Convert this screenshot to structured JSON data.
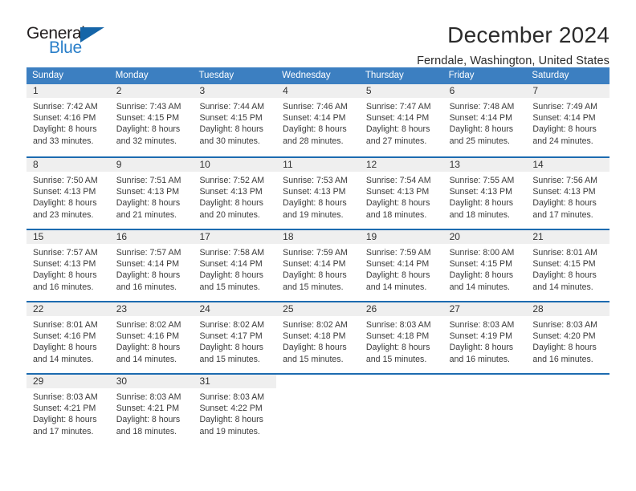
{
  "brand": {
    "name_part1": "General",
    "name_part2": "Blue",
    "triangle_icon": "triangle-icon",
    "color_dark": "#231f20",
    "color_blue": "#2a7fc9"
  },
  "header": {
    "title": "December 2024",
    "location": "Ferndale, Washington, United States"
  },
  "calendar": {
    "header_bg": "#3c7fc1",
    "row_border": "#1d6bb0",
    "band_bg": "#efefef",
    "weekdays": [
      "Sunday",
      "Monday",
      "Tuesday",
      "Wednesday",
      "Thursday",
      "Friday",
      "Saturday"
    ],
    "weeks": [
      [
        {
          "day": "1",
          "sunrise": "Sunrise: 7:42 AM",
          "sunset": "Sunset: 4:16 PM",
          "daylight_line1": "Daylight: 8 hours",
          "daylight_line2": "and 33 minutes."
        },
        {
          "day": "2",
          "sunrise": "Sunrise: 7:43 AM",
          "sunset": "Sunset: 4:15 PM",
          "daylight_line1": "Daylight: 8 hours",
          "daylight_line2": "and 32 minutes."
        },
        {
          "day": "3",
          "sunrise": "Sunrise: 7:44 AM",
          "sunset": "Sunset: 4:15 PM",
          "daylight_line1": "Daylight: 8 hours",
          "daylight_line2": "and 30 minutes."
        },
        {
          "day": "4",
          "sunrise": "Sunrise: 7:46 AM",
          "sunset": "Sunset: 4:14 PM",
          "daylight_line1": "Daylight: 8 hours",
          "daylight_line2": "and 28 minutes."
        },
        {
          "day": "5",
          "sunrise": "Sunrise: 7:47 AM",
          "sunset": "Sunset: 4:14 PM",
          "daylight_line1": "Daylight: 8 hours",
          "daylight_line2": "and 27 minutes."
        },
        {
          "day": "6",
          "sunrise": "Sunrise: 7:48 AM",
          "sunset": "Sunset: 4:14 PM",
          "daylight_line1": "Daylight: 8 hours",
          "daylight_line2": "and 25 minutes."
        },
        {
          "day": "7",
          "sunrise": "Sunrise: 7:49 AM",
          "sunset": "Sunset: 4:14 PM",
          "daylight_line1": "Daylight: 8 hours",
          "daylight_line2": "and 24 minutes."
        }
      ],
      [
        {
          "day": "8",
          "sunrise": "Sunrise: 7:50 AM",
          "sunset": "Sunset: 4:13 PM",
          "daylight_line1": "Daylight: 8 hours",
          "daylight_line2": "and 23 minutes."
        },
        {
          "day": "9",
          "sunrise": "Sunrise: 7:51 AM",
          "sunset": "Sunset: 4:13 PM",
          "daylight_line1": "Daylight: 8 hours",
          "daylight_line2": "and 21 minutes."
        },
        {
          "day": "10",
          "sunrise": "Sunrise: 7:52 AM",
          "sunset": "Sunset: 4:13 PM",
          "daylight_line1": "Daylight: 8 hours",
          "daylight_line2": "and 20 minutes."
        },
        {
          "day": "11",
          "sunrise": "Sunrise: 7:53 AM",
          "sunset": "Sunset: 4:13 PM",
          "daylight_line1": "Daylight: 8 hours",
          "daylight_line2": "and 19 minutes."
        },
        {
          "day": "12",
          "sunrise": "Sunrise: 7:54 AM",
          "sunset": "Sunset: 4:13 PM",
          "daylight_line1": "Daylight: 8 hours",
          "daylight_line2": "and 18 minutes."
        },
        {
          "day": "13",
          "sunrise": "Sunrise: 7:55 AM",
          "sunset": "Sunset: 4:13 PM",
          "daylight_line1": "Daylight: 8 hours",
          "daylight_line2": "and 18 minutes."
        },
        {
          "day": "14",
          "sunrise": "Sunrise: 7:56 AM",
          "sunset": "Sunset: 4:13 PM",
          "daylight_line1": "Daylight: 8 hours",
          "daylight_line2": "and 17 minutes."
        }
      ],
      [
        {
          "day": "15",
          "sunrise": "Sunrise: 7:57 AM",
          "sunset": "Sunset: 4:13 PM",
          "daylight_line1": "Daylight: 8 hours",
          "daylight_line2": "and 16 minutes."
        },
        {
          "day": "16",
          "sunrise": "Sunrise: 7:57 AM",
          "sunset": "Sunset: 4:14 PM",
          "daylight_line1": "Daylight: 8 hours",
          "daylight_line2": "and 16 minutes."
        },
        {
          "day": "17",
          "sunrise": "Sunrise: 7:58 AM",
          "sunset": "Sunset: 4:14 PM",
          "daylight_line1": "Daylight: 8 hours",
          "daylight_line2": "and 15 minutes."
        },
        {
          "day": "18",
          "sunrise": "Sunrise: 7:59 AM",
          "sunset": "Sunset: 4:14 PM",
          "daylight_line1": "Daylight: 8 hours",
          "daylight_line2": "and 15 minutes."
        },
        {
          "day": "19",
          "sunrise": "Sunrise: 7:59 AM",
          "sunset": "Sunset: 4:14 PM",
          "daylight_line1": "Daylight: 8 hours",
          "daylight_line2": "and 14 minutes."
        },
        {
          "day": "20",
          "sunrise": "Sunrise: 8:00 AM",
          "sunset": "Sunset: 4:15 PM",
          "daylight_line1": "Daylight: 8 hours",
          "daylight_line2": "and 14 minutes."
        },
        {
          "day": "21",
          "sunrise": "Sunrise: 8:01 AM",
          "sunset": "Sunset: 4:15 PM",
          "daylight_line1": "Daylight: 8 hours",
          "daylight_line2": "and 14 minutes."
        }
      ],
      [
        {
          "day": "22",
          "sunrise": "Sunrise: 8:01 AM",
          "sunset": "Sunset: 4:16 PM",
          "daylight_line1": "Daylight: 8 hours",
          "daylight_line2": "and 14 minutes."
        },
        {
          "day": "23",
          "sunrise": "Sunrise: 8:02 AM",
          "sunset": "Sunset: 4:16 PM",
          "daylight_line1": "Daylight: 8 hours",
          "daylight_line2": "and 14 minutes."
        },
        {
          "day": "24",
          "sunrise": "Sunrise: 8:02 AM",
          "sunset": "Sunset: 4:17 PM",
          "daylight_line1": "Daylight: 8 hours",
          "daylight_line2": "and 15 minutes."
        },
        {
          "day": "25",
          "sunrise": "Sunrise: 8:02 AM",
          "sunset": "Sunset: 4:18 PM",
          "daylight_line1": "Daylight: 8 hours",
          "daylight_line2": "and 15 minutes."
        },
        {
          "day": "26",
          "sunrise": "Sunrise: 8:03 AM",
          "sunset": "Sunset: 4:18 PM",
          "daylight_line1": "Daylight: 8 hours",
          "daylight_line2": "and 15 minutes."
        },
        {
          "day": "27",
          "sunrise": "Sunrise: 8:03 AM",
          "sunset": "Sunset: 4:19 PM",
          "daylight_line1": "Daylight: 8 hours",
          "daylight_line2": "and 16 minutes."
        },
        {
          "day": "28",
          "sunrise": "Sunrise: 8:03 AM",
          "sunset": "Sunset: 4:20 PM",
          "daylight_line1": "Daylight: 8 hours",
          "daylight_line2": "and 16 minutes."
        }
      ],
      [
        {
          "day": "29",
          "sunrise": "Sunrise: 8:03 AM",
          "sunset": "Sunset: 4:21 PM",
          "daylight_line1": "Daylight: 8 hours",
          "daylight_line2": "and 17 minutes."
        },
        {
          "day": "30",
          "sunrise": "Sunrise: 8:03 AM",
          "sunset": "Sunset: 4:21 PM",
          "daylight_line1": "Daylight: 8 hours",
          "daylight_line2": "and 18 minutes."
        },
        {
          "day": "31",
          "sunrise": "Sunrise: 8:03 AM",
          "sunset": "Sunset: 4:22 PM",
          "daylight_line1": "Daylight: 8 hours",
          "daylight_line2": "and 19 minutes."
        },
        {
          "day": "",
          "sunrise": "",
          "sunset": "",
          "daylight_line1": "",
          "daylight_line2": ""
        },
        {
          "day": "",
          "sunrise": "",
          "sunset": "",
          "daylight_line1": "",
          "daylight_line2": ""
        },
        {
          "day": "",
          "sunrise": "",
          "sunset": "",
          "daylight_line1": "",
          "daylight_line2": ""
        },
        {
          "day": "",
          "sunrise": "",
          "sunset": "",
          "daylight_line1": "",
          "daylight_line2": ""
        }
      ]
    ]
  }
}
